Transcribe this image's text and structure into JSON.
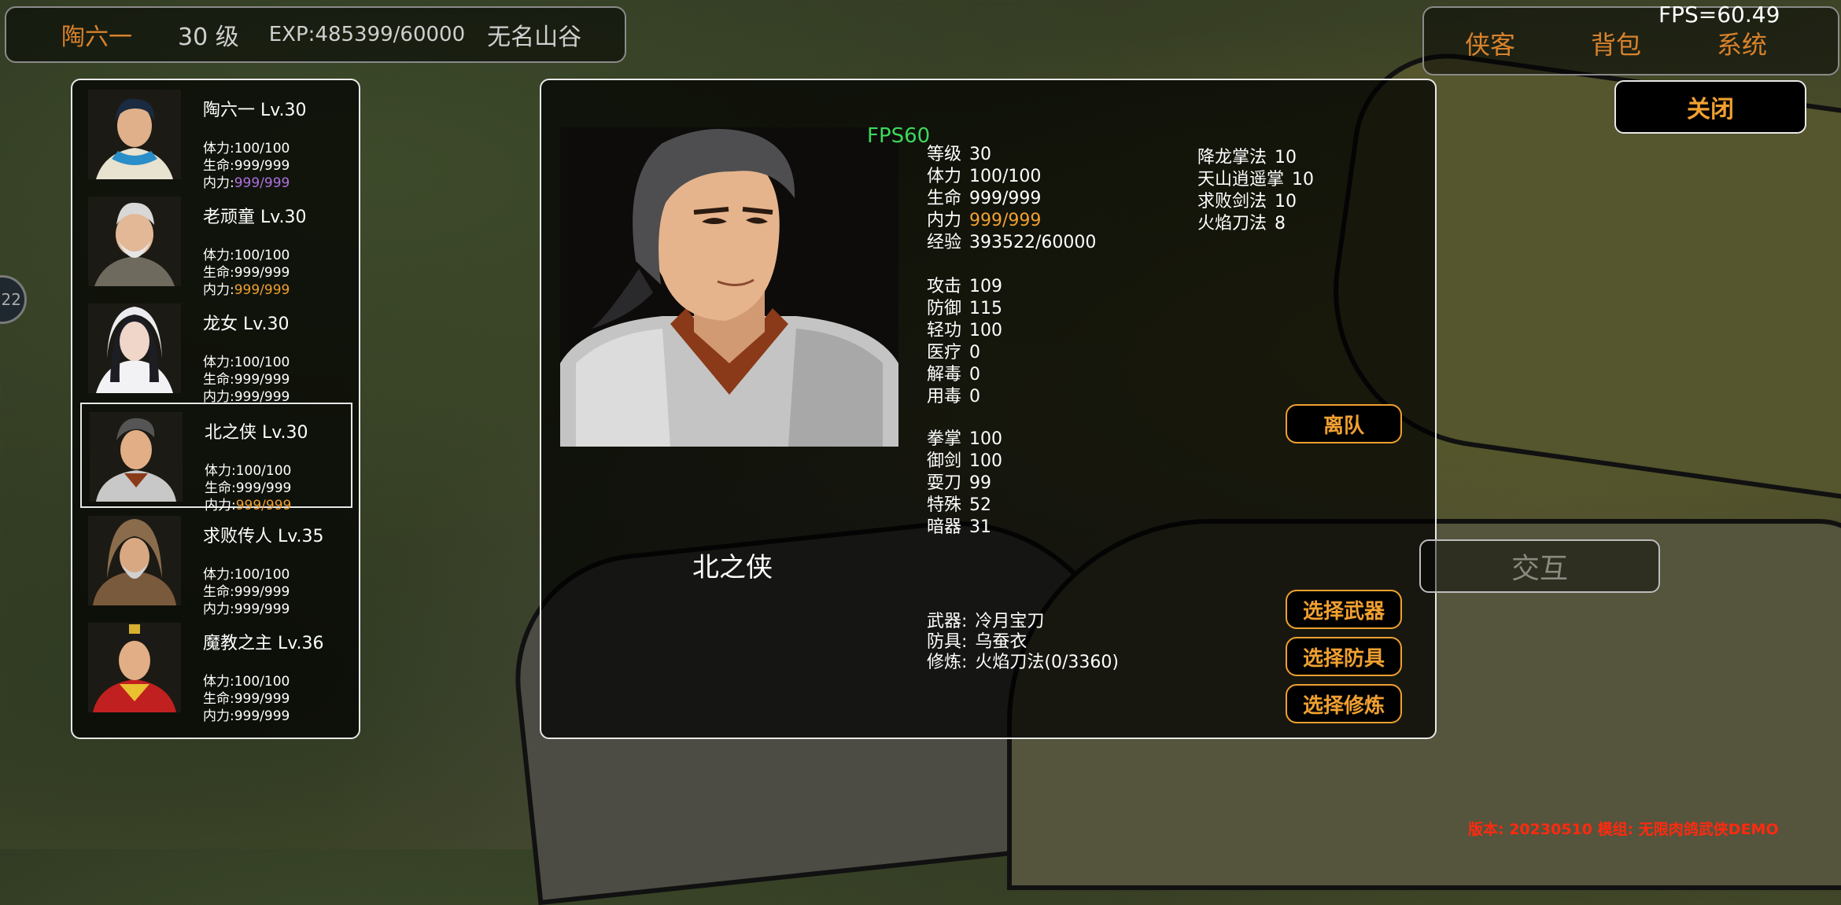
{
  "topbar": {
    "name": "陶六一",
    "level": "30 级",
    "exp": "EXP:485399/60000",
    "location": "无名山谷"
  },
  "menu": {
    "items": [
      "侠客",
      "背包",
      "系统"
    ],
    "fps": "FPS=60.49"
  },
  "close_label": "关闭",
  "side_badge": "22",
  "roster": [
    {
      "name": "陶六一 Lv.30",
      "stamina": "体力:100/100",
      "hp": "生命:999/999",
      "mp_label": "内力:",
      "mp_value": "999/999",
      "mp_color": "#b070e0"
    },
    {
      "name": "老顽童 Lv.30",
      "stamina": "体力:100/100",
      "hp": "生命:999/999",
      "mp_label": "内力:",
      "mp_value": "999/999",
      "mp_color": "#f0a030"
    },
    {
      "name": "龙女 Lv.30",
      "stamina": "体力:100/100",
      "hp": "生命:999/999",
      "mp_label": "内力:",
      "mp_value": "999/999",
      "mp_color": "#ffffff"
    },
    {
      "name": "北之侠 Lv.30",
      "stamina": "体力:100/100",
      "hp": "生命:999/999",
      "mp_label": "内力:",
      "mp_value": "999/999",
      "mp_color": "#f0a030",
      "selected": true
    },
    {
      "name": "求败传人 Lv.35",
      "stamina": "体力:100/100",
      "hp": "生命:999/999",
      "mp_label": "内力:",
      "mp_value": "999/999",
      "mp_color": "#ffffff"
    },
    {
      "name": "魔教之主 Lv.36",
      "stamina": "体力:100/100",
      "hp": "生命:999/999",
      "mp_label": "内力:",
      "mp_value": "999/999",
      "mp_color": "#ffffff"
    }
  ],
  "detail": {
    "fps_overlay": "FPS60",
    "name": "北之侠",
    "basic": [
      {
        "label": "等级",
        "value": "30"
      },
      {
        "label": "体力",
        "value": "100/100"
      },
      {
        "label": "生命",
        "value": "999/999"
      },
      {
        "label": "内力",
        "value": "999/999",
        "highlight": true
      },
      {
        "label": "经验",
        "value": "393522/60000"
      }
    ],
    "combat": [
      {
        "label": "攻击",
        "value": "109"
      },
      {
        "label": "防御",
        "value": "115"
      },
      {
        "label": "轻功",
        "value": "100"
      },
      {
        "label": "医疗",
        "value": "0"
      },
      {
        "label": "解毒",
        "value": "0"
      },
      {
        "label": "用毒",
        "value": "0"
      }
    ],
    "weapons": [
      {
        "label": "拳掌",
        "value": "100"
      },
      {
        "label": "御剑",
        "value": "100"
      },
      {
        "label": "耍刀",
        "value": "99"
      },
      {
        "label": "特殊",
        "value": "52"
      },
      {
        "label": "暗器",
        "value": "31"
      }
    ],
    "skills": [
      {
        "label": "降龙掌法",
        "value": "10"
      },
      {
        "label": "天山逍遥掌",
        "value": "10"
      },
      {
        "label": "求败剑法",
        "value": "10"
      },
      {
        "label": "火焰刀法",
        "value": "8"
      }
    ],
    "equip": [
      {
        "label": "武器:",
        "value": "冷月宝刀"
      },
      {
        "label": "防具:",
        "value": "乌蚕衣"
      },
      {
        "label": "修炼:",
        "value": "火焰刀法(0/3360)"
      }
    ],
    "leave_label": "离队",
    "select_weapon": "选择武器",
    "select_armor": "选择防具",
    "select_train": "选择修炼"
  },
  "interact_label": "交互",
  "version": "版本: 20230510 模组: 无限肉鸽武侠DEMO"
}
